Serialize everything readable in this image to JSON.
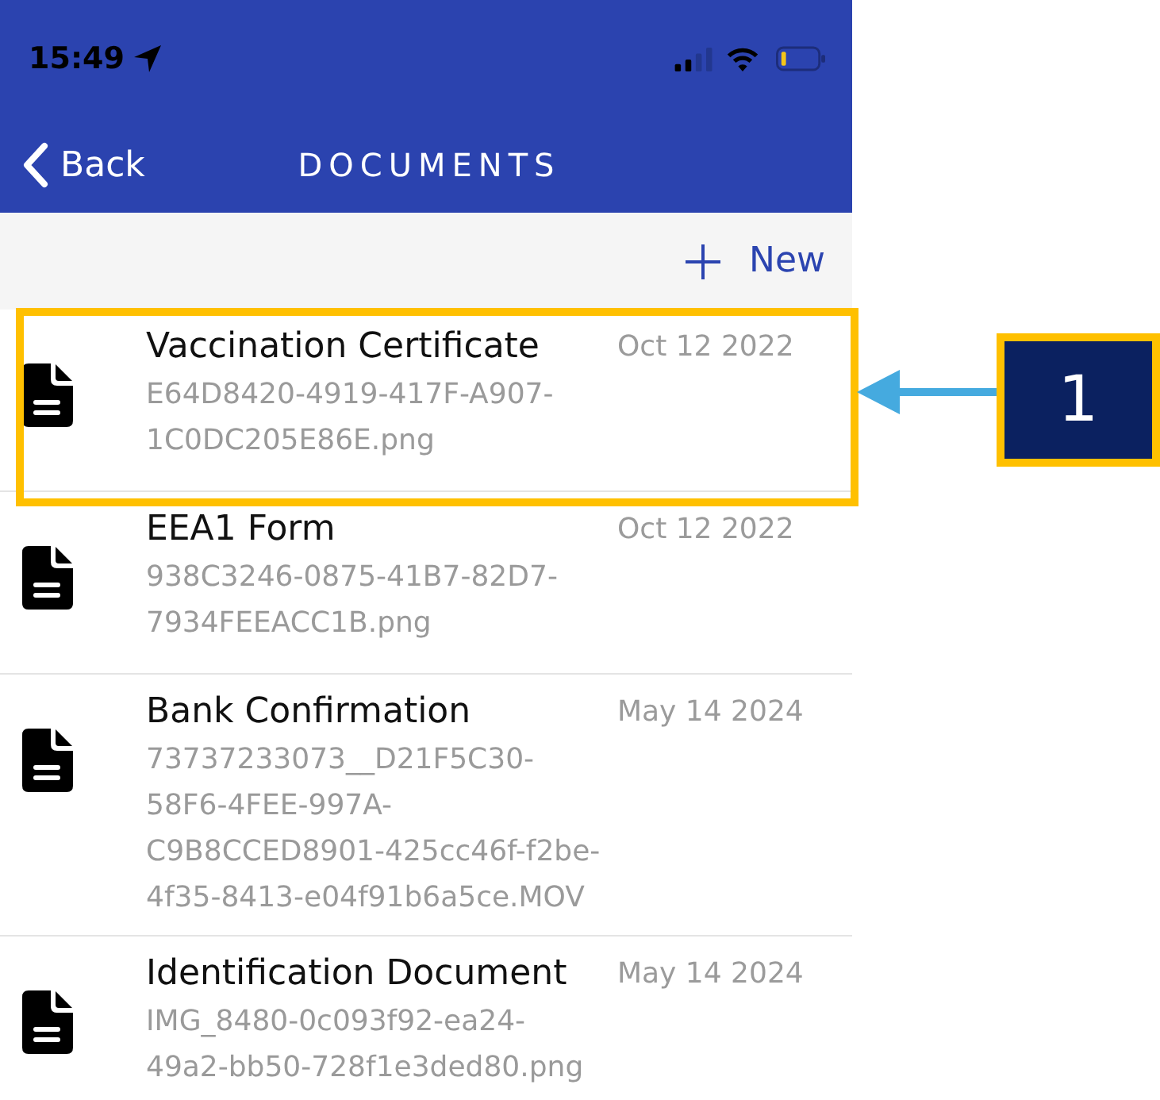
{
  "status_bar": {
    "time": "15:49"
  },
  "nav_bar": {
    "back_label": "Back",
    "title": "DOCUMENTS"
  },
  "toolbar": {
    "new_label": "New"
  },
  "documents": [
    {
      "title": "Vaccination Certificate",
      "file_name": "E64D8420-4919-417F-A907-\n1C0DC205E86E.png",
      "date": "Oct 12 2022",
      "highlighted": true
    },
    {
      "title": "EEA1 Form",
      "file_name": "938C3246-0875-41B7-82D7-\n7934FEEACC1B.png",
      "date": "Oct 12 2022",
      "highlighted": false
    },
    {
      "title": "Bank Confirmation",
      "file_name": "73737233073__D21F5C30-\n58F6-4FEE-997A-\nC9B8CCED8901-425cc46f-f2be-\n4f35-8413-e04f91b6a5ce.MOV",
      "date": "May 14 2024",
      "highlighted": false
    },
    {
      "title": "Identification Document",
      "file_name": "IMG_8480-0c093f92-ea24-\n49a2-bb50-728f1e3ded80.png",
      "date": "May 14 2024",
      "highlighted": false
    }
  ],
  "annotation": {
    "label": "1"
  }
}
